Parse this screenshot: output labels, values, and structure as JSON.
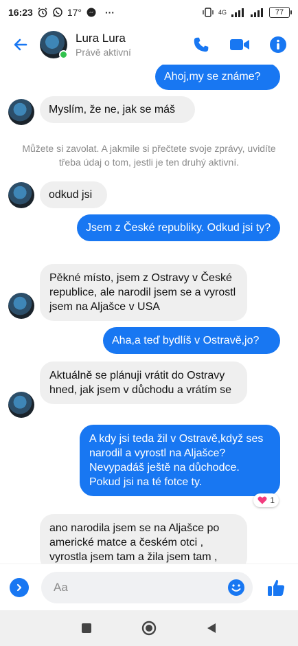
{
  "status_bar": {
    "time": "16:23",
    "temperature": "17°",
    "more": "···",
    "network": "4G",
    "battery": "77"
  },
  "header": {
    "contact_name": "Lura Lura",
    "contact_status": "Právě aktivní"
  },
  "chat": {
    "messages": [
      {
        "side": "out",
        "text": "Ahoj,my se známe?"
      },
      {
        "side": "in",
        "text": "Myslím, že ne, jak se máš"
      },
      {
        "side": "system",
        "text": "Můžete si zavolat. A jakmile si přečtete svoje zprávy, uvidíte třeba údaj o tom, jestli je ten druhý aktivní."
      },
      {
        "side": "in",
        "text": "odkud jsi"
      },
      {
        "side": "out",
        "text": "Jsem z České republiky. Odkud jsi ty?"
      },
      {
        "side": "in",
        "text": "Pěkné místo, jsem z Ostravy v České republice, ale narodil jsem se a vyrostl jsem na Aljašce v USA"
      },
      {
        "side": "out",
        "text": "Aha,a teď bydlíš v Ostravě,jo?"
      },
      {
        "side": "in",
        "text": "Aktuálně se plánuji vrátit do Ostravy hned, jak jsem v důchodu a vrátím se"
      },
      {
        "side": "out",
        "text": "A kdy jsi teda žil v Ostravě,když ses narodil a vyrostl na Aljašce? Nevypadáš ještě na důchodce. Pokud jsi na té fotce ty."
      },
      {
        "side": "in",
        "text": "ano narodila jsem se na Aljašce po americké matce a českém otci , vyrostla jsem tam a žila jsem tam ,"
      }
    ],
    "reaction": {
      "emoji": "heart",
      "count": "1"
    }
  },
  "composer": {
    "placeholder": "Aa"
  },
  "colors": {
    "accent": "#1877f2",
    "incoming_bubble": "#efefef",
    "online": "#31c24d"
  },
  "icons": {
    "back": "arrow-left-icon",
    "call": "phone-icon",
    "video": "video-camera-icon",
    "info": "info-icon",
    "expand": "chevron-right-icon",
    "emoji": "smiley-icon",
    "like": "thumbs-up-icon"
  }
}
